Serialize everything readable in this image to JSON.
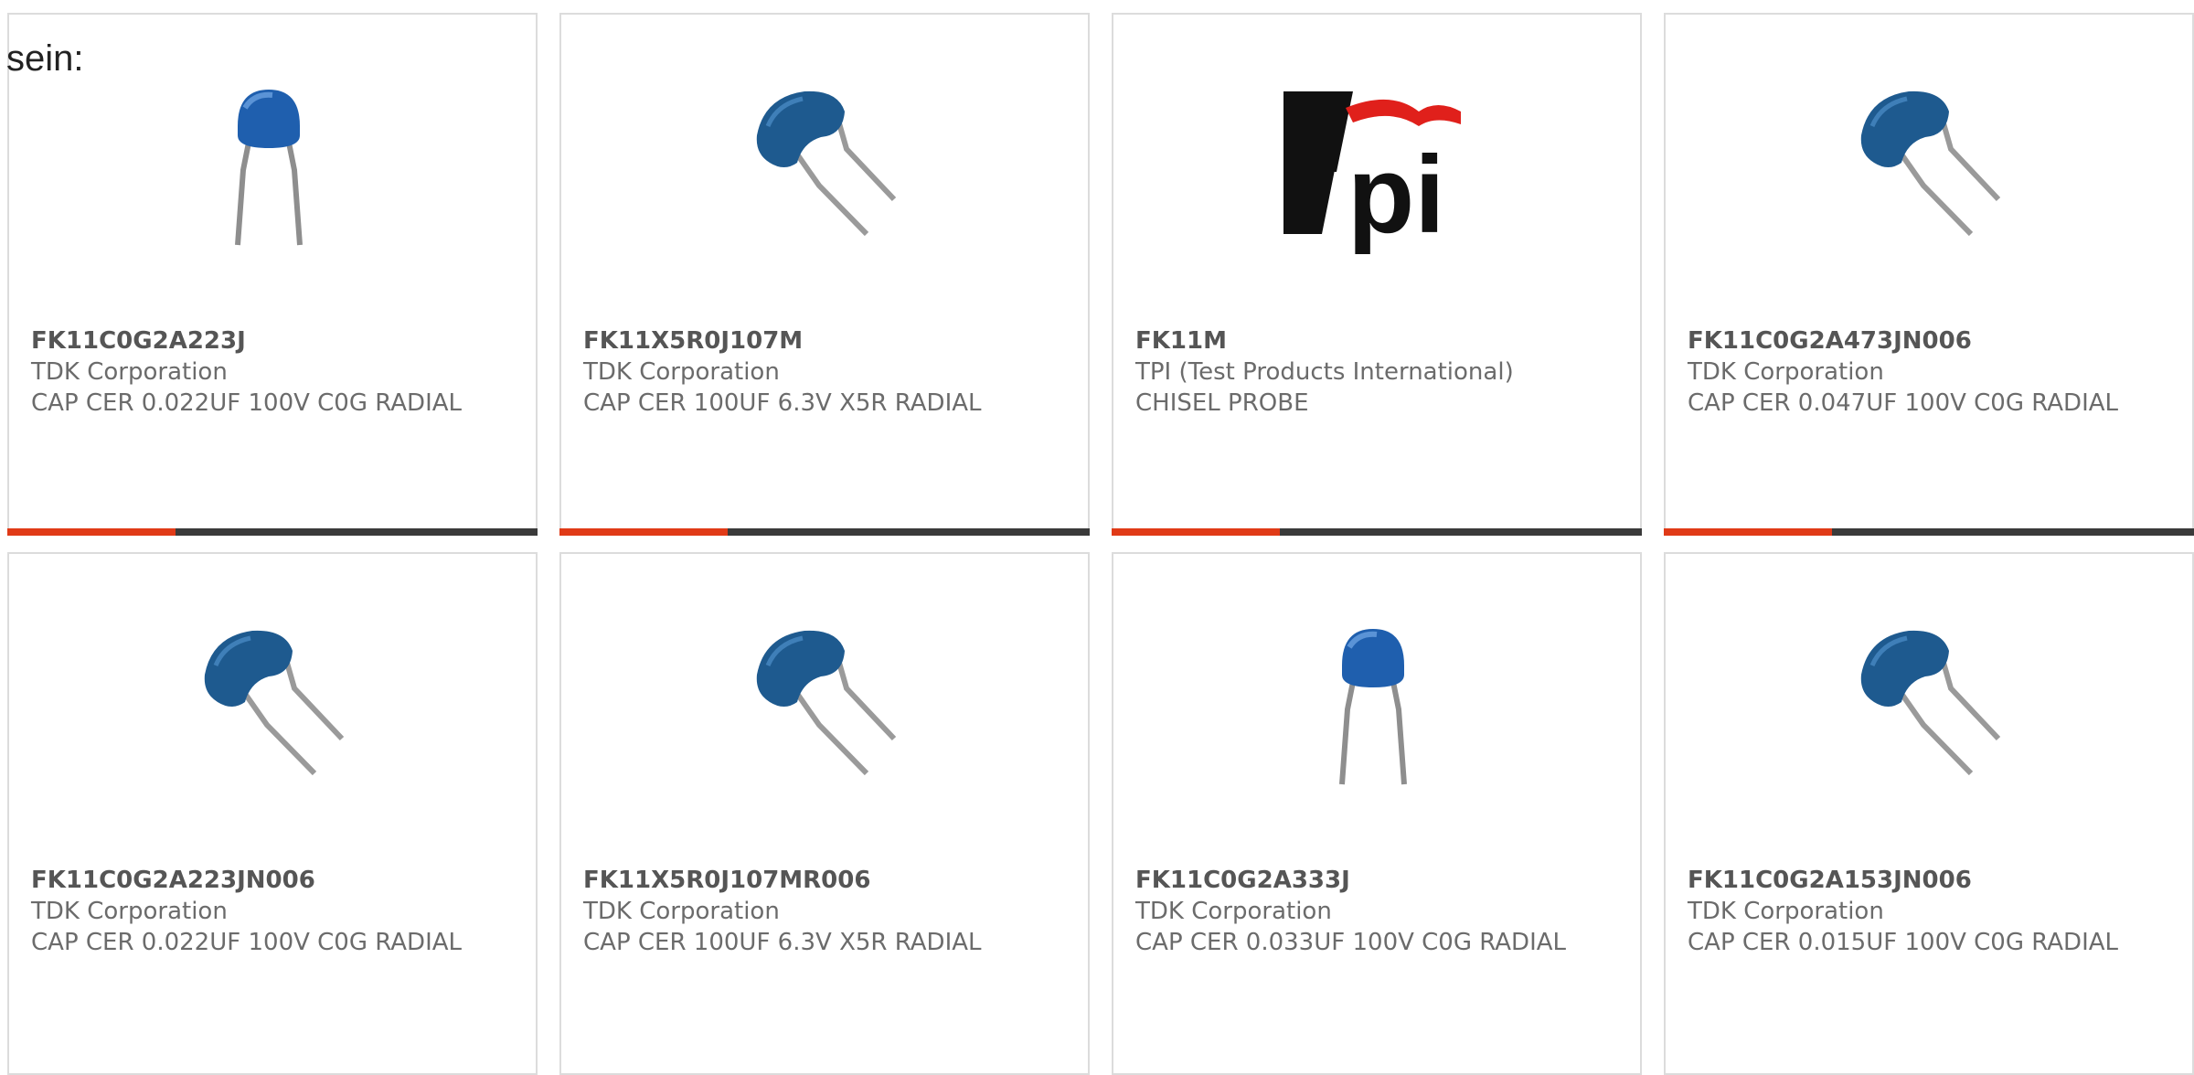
{
  "intro_text": "sein:",
  "colors": {
    "accent": "#e03a17",
    "bar": "#3a3a3a",
    "border": "#dcdcdc"
  },
  "products": [
    {
      "part_number": "FK11C0G2A223J",
      "manufacturer": "TDK Corporation",
      "description": "CAP CER 0.022UF 100V C0G RADIAL",
      "image": "straight-lead-capacitor"
    },
    {
      "part_number": "FK11X5R0J107M",
      "manufacturer": "TDK Corporation",
      "description": "CAP CER 100UF 6.3V X5R RADIAL",
      "image": "bent-lead-capacitor"
    },
    {
      "part_number": "FK11M",
      "manufacturer": "TPI (Test Products International)",
      "description": "CHISEL PROBE",
      "image": "tpi-logo",
      "logo_text": "tpi"
    },
    {
      "part_number": "FK11C0G2A473JN006",
      "manufacturer": "TDK Corporation",
      "description": "CAP CER 0.047UF 100V C0G RADIAL",
      "image": "bent-lead-capacitor"
    },
    {
      "part_number": "FK11C0G2A223JN006",
      "manufacturer": "TDK Corporation",
      "description": "CAP CER 0.022UF 100V C0G RADIAL",
      "image": "bent-lead-capacitor"
    },
    {
      "part_number": "FK11X5R0J107MR006",
      "manufacturer": "TDK Corporation",
      "description": "CAP CER 100UF 6.3V X5R RADIAL",
      "image": "bent-lead-capacitor"
    },
    {
      "part_number": "FK11C0G2A333J",
      "manufacturer": "TDK Corporation",
      "description": "CAP CER 0.033UF 100V C0G RADIAL",
      "image": "straight-lead-capacitor"
    },
    {
      "part_number": "FK11C0G2A153JN006",
      "manufacturer": "TDK Corporation",
      "description": "CAP CER 0.015UF 100V C0G RADIAL",
      "image": "bent-lead-capacitor"
    }
  ]
}
